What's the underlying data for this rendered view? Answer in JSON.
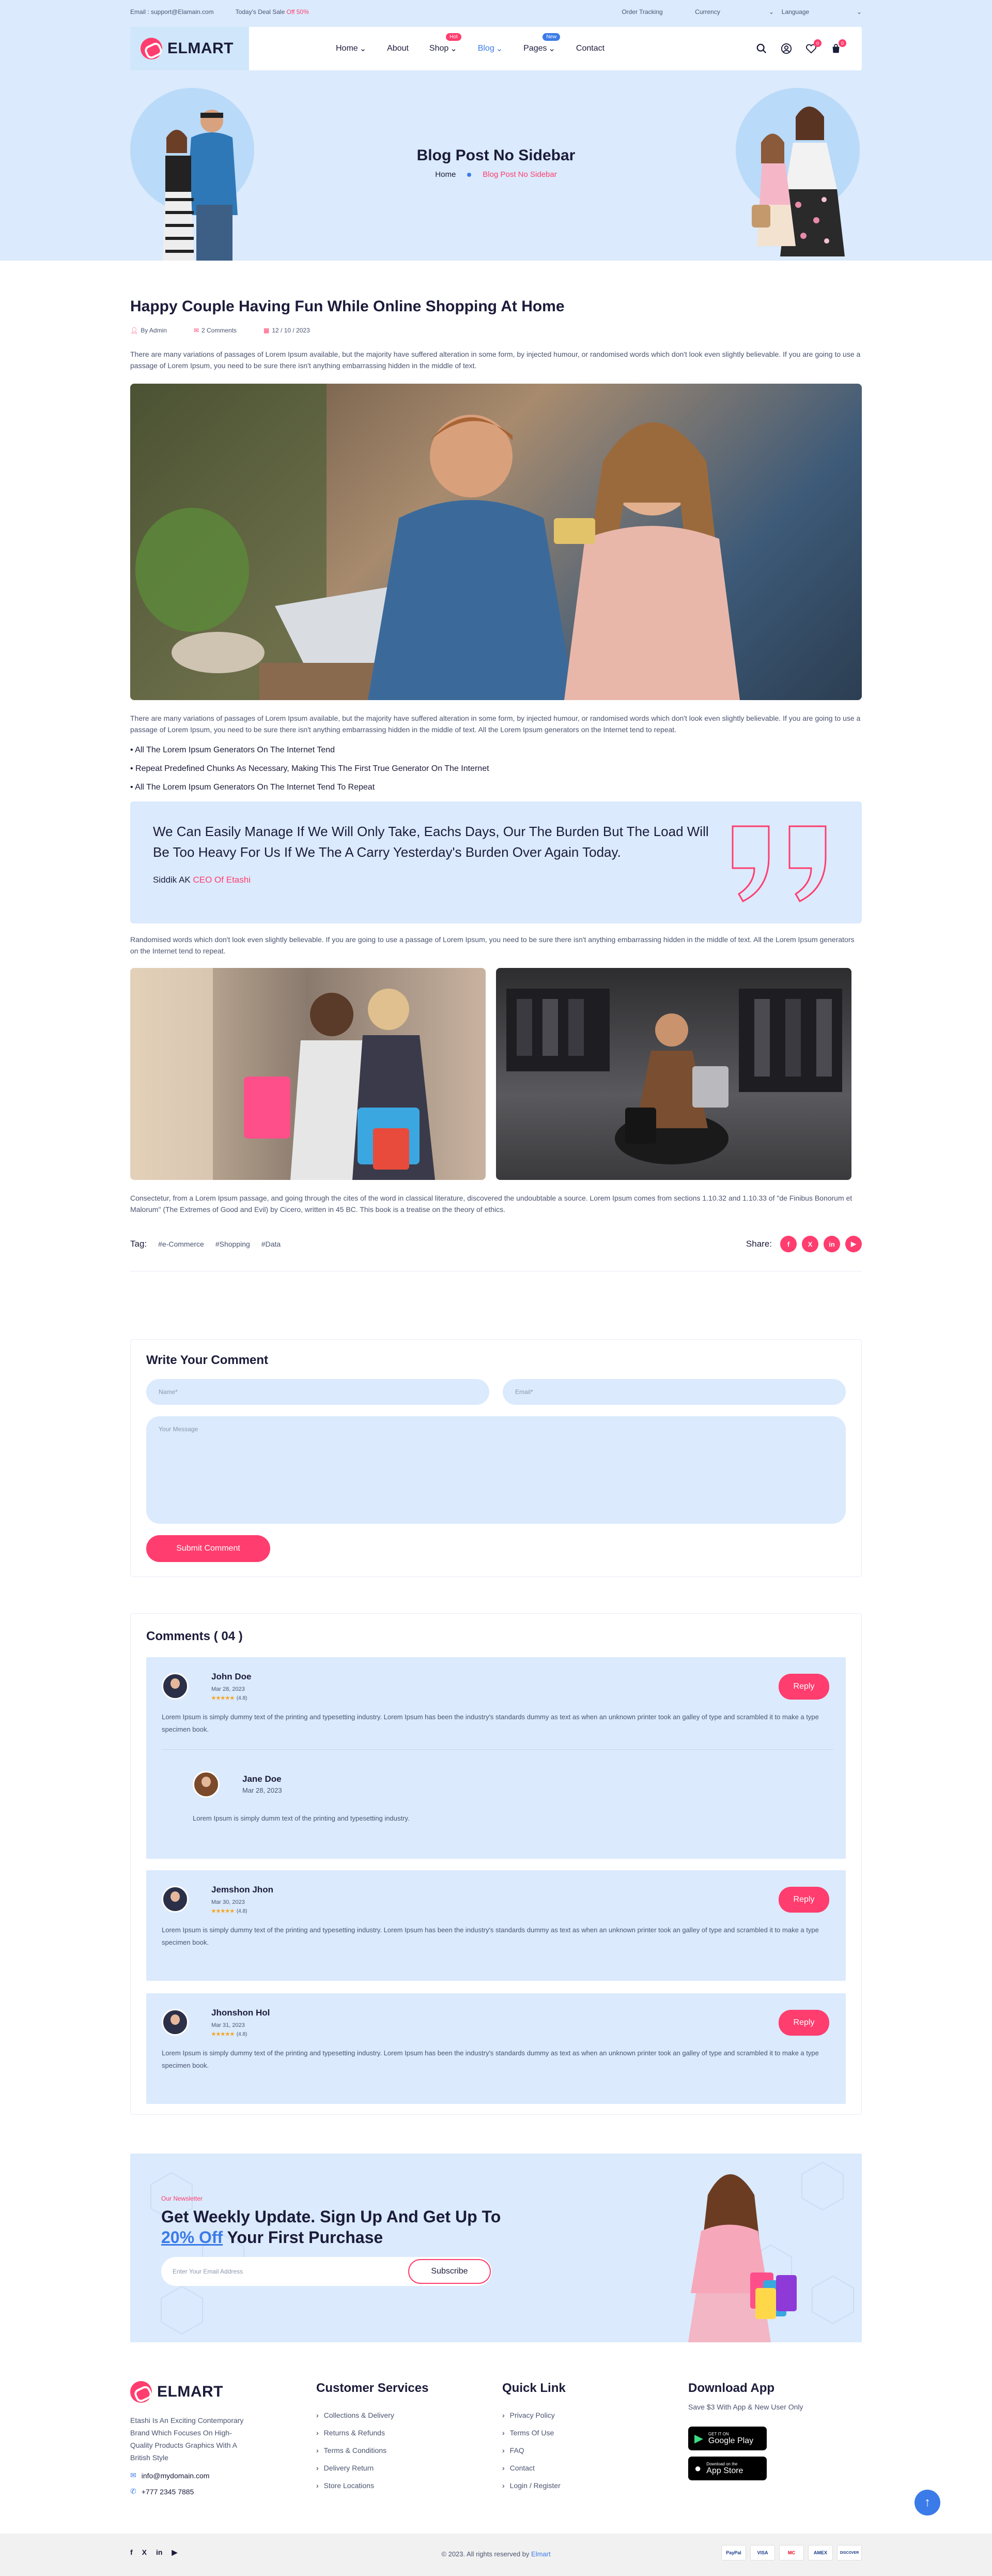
{
  "topbar": {
    "email": "Email : support@Elamain.com",
    "deal_prefix": "Today's Deal Sale",
    "deal_pct": "Off 50%",
    "order_tracking": "Order Tracking",
    "currency": "Currency",
    "language": "Language"
  },
  "brand": {
    "name": "ELMART"
  },
  "nav": [
    {
      "label": "Home",
      "caret": true,
      "badge": "",
      "active": false
    },
    {
      "label": "About",
      "caret": false,
      "badge": "",
      "active": false
    },
    {
      "label": "Shop",
      "caret": true,
      "badge": "Hot",
      "badge_color": "#ff3d6e",
      "active": false
    },
    {
      "label": "Blog",
      "caret": true,
      "badge": "",
      "active": true
    },
    {
      "label": "Pages",
      "caret": true,
      "badge": "New",
      "badge_color": "#3b7be9",
      "active": false
    },
    {
      "label": "Contact",
      "caret": false,
      "badge": "",
      "active": false
    }
  ],
  "header_counts": {
    "wishlist": "0",
    "cart": "0"
  },
  "hero": {
    "title": "Blog Post No Sidebar",
    "crumb_home": "Home",
    "crumb_current": "Blog Post No Sidebar"
  },
  "post": {
    "title": "Happy Couple Having Fun While Online Shopping At Home",
    "author": "By Admin",
    "comments": "2 Comments",
    "date": "12 / 10 / 2023",
    "intro": "There are many variations of passages of Lorem Ipsum available, but the majority have suffered alteration in some form, by injected humour, or randomised words which don't look even slightly believable. If you are going to use a passage of Lorem Ipsum, you need to be sure there isn't anything embarrassing hidden in the middle of text.",
    "para2": "There are many variations of passages of Lorem Ipsum available, but the majority have suffered alteration in some form, by injected humour, or randomised words which don't look even slightly believable. If you are going to use a passage of Lorem Ipsum, you need to be sure there isn't anything embarrassing hidden in the middle of text. All the Lorem Ipsum generators on the Internet tend to repeat.",
    "bullets": [
      "All The Lorem Ipsum Generators On The Internet Tend",
      "Repeat Predefined Chunks As Necessary, Making This The First True Generator On The Internet",
      "All The Lorem Ipsum Generators On The Internet Tend To Repeat"
    ],
    "quote": "We Can Easily Manage If We Will Only Take, Eachs Days, Our The Burden But The Load Will Be Too Heavy For Us If We The A Carry Yesterday's Burden Over Again Today.",
    "quote_author": "Siddik AK",
    "quote_role": "CEO Of Etashi",
    "para3": "Randomised words which don't look even slightly believable. If you are going to use a passage of Lorem Ipsum, you need to be sure there isn't anything embarrassing hidden in the middle of text. All the Lorem Ipsum generators on the Internet tend to repeat.",
    "para4": "Consectetur, from a Lorem Ipsum passage, and going through the cites of the word in classical literature, discovered the undoubtable a source. Lorem Ipsum comes from sections 1.10.32 and 1.10.33 of \"de Finibus Bonorum et Malorum\" (The Extremes of Good and Evil) by Cicero, written in 45 BC. This book is a treatise on the theory of ethics.",
    "tag_label": "Tag:",
    "tags": [
      "#e-Commerce",
      "#Shopping",
      "#Data"
    ],
    "share_label": "Share:",
    "share_icons": [
      "f",
      "X",
      "in",
      "▶"
    ]
  },
  "comment_form": {
    "title": "Write Your Comment",
    "name_ph": "Name*",
    "email_ph": "Email*",
    "message_ph": "Your Message",
    "submit": "Submit Comment"
  },
  "comments": {
    "title": "Comments ( 04 )",
    "reply": "Reply",
    "items": [
      {
        "name": "John Doe",
        "date": "Mar 28, 2023",
        "stars": "★★★★★",
        "rating": "(4.8)",
        "text": "Lorem Ipsum is simply dummy text of the printing and typesetting industry. Lorem Ipsum has been the industry's standards dummy as text as when an unknown printer took an galley of type and scrambled it to make a type specimen book."
      },
      {
        "name": "Jane Doe",
        "date": "Mar 28, 2023",
        "text": "Lorem Ipsum is simply dumm text of the printing and typesetting industry."
      },
      {
        "name": "Jemshon Jhon",
        "date": "Mar 30, 2023",
        "stars": "★★★★★",
        "rating": "(4.8)",
        "text": "Lorem Ipsum is simply dummy text of the printing and typesetting industry. Lorem Ipsum has been the industry's standards dummy as text as when an unknown printer took an galley of type and scrambled it to make a type specimen book."
      },
      {
        "name": "Jhonshon Hol",
        "date": "Mar 31, 2023",
        "stars": "★★★★★",
        "rating": "(4.8)",
        "text": "Lorem Ipsum is simply dummy text of the printing and typesetting industry. Lorem Ipsum has been the industry's standards dummy as text as when an unknown printer took an galley of type and scrambled it to make a type specimen book."
      }
    ]
  },
  "newsletter": {
    "kicker": "Our Newsletter",
    "title_line1": "Get Weekly Update. Sign Up And Get Up To",
    "offer": "20% Off",
    "title_rest": "Your First Purchase",
    "placeholder": "Enter Your Email Address",
    "button": "Subscribe"
  },
  "footer": {
    "desc": "Etashi Is An Exciting Contemporary Brand Which Focuses On High-Quality Products Graphics With A British Style",
    "email": "info@mydomain.com",
    "phone": "+777 2345 7885",
    "services_title": "Customer Services",
    "services": [
      "Collections & Delivery",
      "Returns & Refunds",
      "Terms & Conditions",
      "Delivery Return",
      "Store Locations"
    ],
    "quick_title": "Quick Link",
    "quick": [
      "Privacy Policy",
      "Terms Of Use",
      "FAQ",
      "Contact",
      "Login / Register"
    ],
    "app_title": "Download App",
    "app_sub": "Save $3 With App & New User Only",
    "gp_small": "GET IT ON",
    "gp_big": "Google Play",
    "as_small": "Download on the",
    "as_big": "App Store",
    "copyright": "© 2023. All rights reserved by",
    "copyright_brand": "Elmart",
    "social": [
      "f",
      "X",
      "in",
      "▶"
    ],
    "payments": [
      "PayPal",
      "VISA",
      "MC",
      "AMEX",
      "DISCOVER"
    ],
    "to_top": "↑"
  }
}
